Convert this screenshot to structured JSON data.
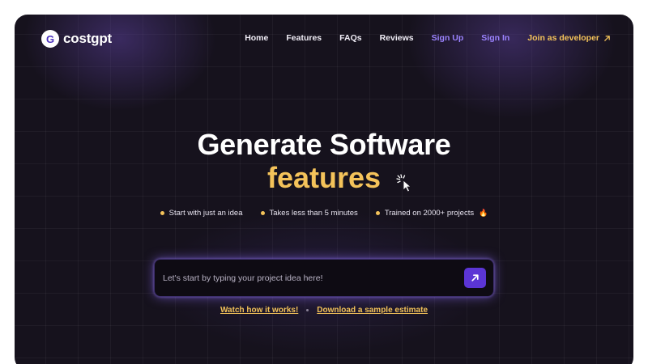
{
  "brand": {
    "logo_letter": "G",
    "name": "costgpt"
  },
  "nav": {
    "home": "Home",
    "features": "Features",
    "faqs": "FAQs",
    "reviews": "Reviews",
    "sign_up": "Sign Up",
    "sign_in": "Sign In",
    "developer": "Join as developer"
  },
  "hero": {
    "title": "Generate Software",
    "accent": "features",
    "bullets": [
      {
        "text": "Start with just an idea"
      },
      {
        "text": "Takes less than 5 minutes"
      },
      {
        "text": "Trained on 2000+ projects",
        "emoji": "🔥"
      }
    ]
  },
  "search": {
    "placeholder": "Let's start by typing your project idea here!",
    "value": ""
  },
  "links": {
    "watch": "Watch how it works!",
    "download": "Download a sample estimate"
  },
  "colors": {
    "background": "#16121d",
    "accent_yellow": "#f4c35a",
    "accent_purple": "#9b83ff",
    "button_purple": "#5b35d5"
  },
  "icons": {
    "cursor": "cursor-click-icon",
    "arrow": "arrow-up-right-icon",
    "fire": "fire-icon"
  }
}
